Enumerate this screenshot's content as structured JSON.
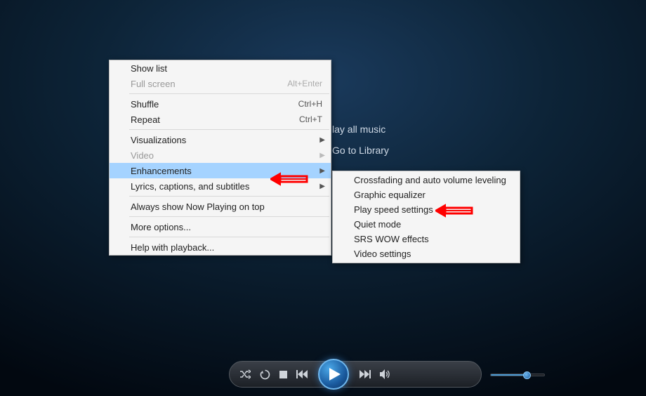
{
  "background_links": {
    "play_all": "lay all music",
    "go_library": "Go to Library"
  },
  "menu": {
    "show_list": "Show list",
    "full_screen": {
      "label": "Full screen",
      "shortcut": "Alt+Enter"
    },
    "shuffle": {
      "label": "Shuffle",
      "shortcut": "Ctrl+H"
    },
    "repeat": {
      "label": "Repeat",
      "shortcut": "Ctrl+T"
    },
    "visualizations": "Visualizations",
    "video": "Video",
    "enhancements": "Enhancements",
    "lyrics": "Lyrics, captions, and subtitles",
    "always_top": "Always show Now Playing on top",
    "more_options": "More options...",
    "help": "Help with playback..."
  },
  "submenu": {
    "crossfading": "Crossfading and auto volume leveling",
    "equalizer": "Graphic equalizer",
    "play_speed": "Play speed settings",
    "quiet_mode": "Quiet mode",
    "srs_wow": "SRS WOW effects",
    "video_settings": "Video settings"
  }
}
